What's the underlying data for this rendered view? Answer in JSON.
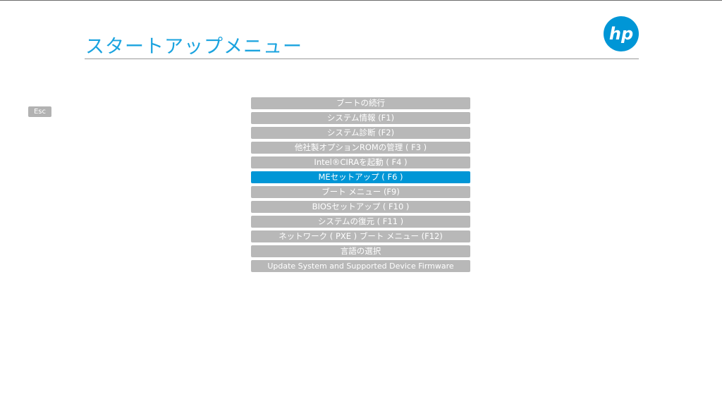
{
  "header": {
    "title": "スタートアップメニュー",
    "logo_text": "hp",
    "accent_color": "#0096d6"
  },
  "esc": {
    "label": "Esc"
  },
  "menu": {
    "selected_index": 5,
    "items": [
      {
        "label": "ブートの続行"
      },
      {
        "label": "システム情報 (F1)"
      },
      {
        "label": "システム診断 (F2)"
      },
      {
        "label": "他社製オプションROMの管理 ( F3 )"
      },
      {
        "label": "Intel®CIRAを起動 ( F4 )"
      },
      {
        "label": "MEセットアップ ( F6 )"
      },
      {
        "label": "ブート メニュー (F9)"
      },
      {
        "label": "BIOSセットアップ ( F10 )"
      },
      {
        "label": "システムの復元 ( F11 )"
      },
      {
        "label": "ネットワーク ( PXE ) ブート メニュー (F12)"
      },
      {
        "label": "言語の選択"
      },
      {
        "label": "Update System and Supported Device Firmware"
      }
    ]
  }
}
